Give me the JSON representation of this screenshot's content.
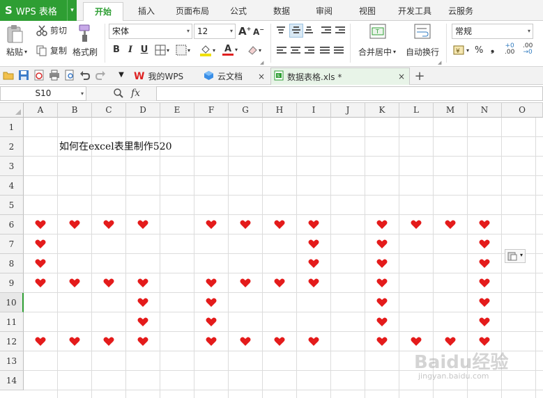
{
  "app": {
    "logo": "S",
    "name": "WPS 表格",
    "dropdown": "▾"
  },
  "menu": {
    "tabs": [
      "开始",
      "插入",
      "页面布局",
      "公式",
      "数据",
      "审阅",
      "视图",
      "开发工具",
      "云服务"
    ],
    "active": "开始"
  },
  "ribbon": {
    "paste": "粘贴",
    "cut": "剪切",
    "copy": "复制",
    "format_painter": "格式刷",
    "font_name": "宋体",
    "font_size": "12",
    "merge_center": "合并居中",
    "wrap_text": "自动换行",
    "number_format": "常规",
    "percent": "%",
    "comma": "❟",
    "increase_decimal": ".00",
    "decrease_decimal": ".00"
  },
  "quick_bar": {
    "tabs": [
      {
        "label": "我的WPS",
        "icon": "wps-logo-icon",
        "closable": false
      },
      {
        "label": "云文档",
        "icon": "cloud-doc-icon",
        "closable": true
      },
      {
        "label": "数据表格.xls *",
        "icon": "spreadsheet-file-icon",
        "closable": true,
        "active": true
      }
    ],
    "new_tab": "+"
  },
  "formula_bar": {
    "name_box": "S10",
    "fx_label": "fx",
    "formula": ""
  },
  "sheet": {
    "columns": [
      "A",
      "B",
      "C",
      "D",
      "E",
      "F",
      "G",
      "H",
      "I",
      "J",
      "K",
      "L",
      "M",
      "N",
      "O"
    ],
    "rows": [
      "1",
      "2",
      "3",
      "4",
      "5",
      "6",
      "7",
      "8",
      "9",
      "10",
      "11",
      "12",
      "13",
      "14"
    ],
    "active_row": "10",
    "cells": {
      "B2": "如何在excel表里制作520"
    },
    "heart_color": "#e41b1b",
    "hearts": [
      "A6",
      "B6",
      "C6",
      "D6",
      "F6",
      "G6",
      "H6",
      "I6",
      "K6",
      "L6",
      "M6",
      "N6",
      "A7",
      "I7",
      "K7",
      "N7",
      "A8",
      "I8",
      "K8",
      "N8",
      "A9",
      "B9",
      "C9",
      "D9",
      "F9",
      "G9",
      "H9",
      "I9",
      "K9",
      "N9",
      "D10",
      "F10",
      "K10",
      "N10",
      "D11",
      "F11",
      "K11",
      "N11",
      "A12",
      "B12",
      "C12",
      "D12",
      "F12",
      "G12",
      "H12",
      "I12",
      "K12",
      "L12",
      "M12",
      "N12"
    ]
  },
  "watermark": {
    "text": "Baidu经验",
    "sub": "jingyan.baidu.com"
  },
  "colors": {
    "accent": "#2e9e33",
    "heart": "#e41b1b",
    "grid_line": "#dcdcdc",
    "header_bg": "#f3f3f3"
  }
}
